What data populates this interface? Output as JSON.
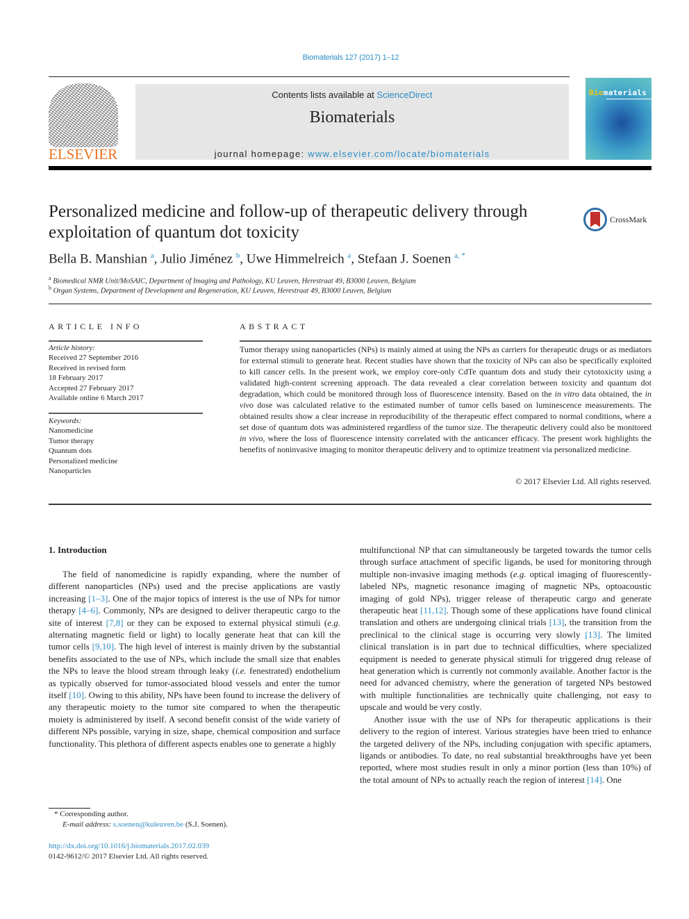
{
  "header": {
    "citation": "Biomaterials 127 (2017) 1–12",
    "contents_prefix": "Contents lists available at ",
    "contents_link": "ScienceDirect",
    "journal_name": "Biomaterials",
    "homepage_prefix": "journal homepage: ",
    "homepage_link": "www.elsevier.com/locate/biomaterials",
    "publisher": "ELSEVIER",
    "cover_title_bold": "Bio",
    "cover_title_rest": "materials",
    "crossmark": "CrossMark"
  },
  "article": {
    "title": "Personalized medicine and follow-up of therapeutic delivery through exploitation of quantum dot toxicity",
    "authors": [
      {
        "name": "Bella B. Manshian",
        "sup": "a"
      },
      {
        "name": "Julio Jiménez",
        "sup": "b"
      },
      {
        "name": "Uwe Himmelreich",
        "sup": "a"
      },
      {
        "name": "Stefaan J. Soenen",
        "sup": "a, *"
      }
    ],
    "affiliations": [
      {
        "sup": "a",
        "text": "Biomedical NMR Unit/MoSAIC, Department of Imaging and Pathology, KU Leuven, Herestraat 49, B3000 Leuven, Belgium"
      },
      {
        "sup": "b",
        "text": "Organ Systems, Department of Development and Regeneration, KU Leuven, Herestraat 49, B3000 Leuven, Belgium"
      }
    ]
  },
  "article_info": {
    "heading": "ARTICLE INFO",
    "history_label": "Article history:",
    "history": [
      "Received 27 September 2016",
      "Received in revised form",
      "18 February 2017",
      "Accepted 27 February 2017",
      "Available online 6 March 2017"
    ],
    "keywords_label": "Keywords:",
    "keywords": [
      "Nanomedicine",
      "Tumor therapy",
      "Quantum dots",
      "Personalized medicine",
      "Nanoparticles"
    ]
  },
  "abstract": {
    "heading": "ABSTRACT",
    "p1": "Tumor therapy using nanoparticles (NPs) is mainly aimed at using the NPs as carriers for therapeutic drugs or as mediators for external stimuli to generate heat. Recent studies have shown that the toxicity of NPs can also be specifically exploited to kill cancer cells. In the present work, we employ core-only CdTe quantum dots and study their cytotoxicity using a validated high-content screening approach. The data revealed a clear correlation between toxicity and quantum dot degradation, which could be monitored through loss of fluorescence intensity. Based on the ",
    "it1": "in vitro",
    "p2": " data obtained, the ",
    "it2": "in vivo",
    "p3": " dose was calculated relative to the estimated number of tumor cells based on luminescence measurements. The obtained results show a clear increase in reproducibility of the therapeutic effect compared to normal conditions, where a set dose of quantum dots was administered regardless of the tumor size. The therapeutic delivery could also be monitored ",
    "it3": "in vivo",
    "p4": ", where the loss of fluorescence intensity correlated with the anticancer efficacy. The present work highlights the benefits of noninvasive imaging to monitor therapeutic delivery and to optimize treatment via personalized medicine.",
    "copyright": "© 2017 Elsevier Ltd. All rights reserved."
  },
  "body": {
    "intro_heading": "1.  Introduction",
    "left": {
      "a": "The field of nanomedicine is rapidly expanding, where the number of different nanoparticles (NPs) used and the precise applications are vastly increasing ",
      "r1": "[1–3]",
      "b": ". One of the major topics of interest is the use of NPs for tumor therapy ",
      "r2": "[4–6]",
      "c": ". Commonly, NPs are designed to deliver therapeutic cargo to the site of interest ",
      "r3": "[7,8]",
      "d": " or they can be exposed to external physical stimuli (",
      "eg": "e.g.",
      "e": " alternating magnetic field or light) to locally generate heat that can kill the tumor cells ",
      "r4": "[9,10]",
      "f": ". The high level of interest is mainly driven by the substantial benefits associated to the use of NPs, which include the small size that enables the NPs to leave the blood stream through leaky (",
      "ie": "i.e.",
      "g": " fenestrated) endothelium as typically observed for tumor-associated blood vessels and enter the tumor itself ",
      "r5": "[10]",
      "h": ". Owing to this ability, NPs have been found to increase the delivery of any therapeutic moiety to the tumor site compared to when the therapeutic moiety is administered by itself. A second benefit consist of the wide variety of different NPs possible, varying in size, shape, chemical composition and surface functionality. This plethora of different aspects enables one to generate a highly"
    },
    "right": {
      "a": "multifunctional NP that can simultaneously be targeted towards the tumor cells through surface attachment of specific ligands, be used for monitoring through multiple non-invasive imaging methods (",
      "eg": "e.g.",
      "b": " optical imaging of fluorescently-labeled NPs, magnetic resonance imaging of magnetic NPs, optoacoustic imaging of gold NPs), trigger release of therapeutic cargo and generate therapeutic heat ",
      "r1": "[11,12]",
      "c": ". Though some of these applications have found clinical translation and others are undergoing clinical trials ",
      "r2": "[13]",
      "d": ", the transition from the preclinical to the clinical stage is occurring very slowly ",
      "r3": "[13]",
      "e": ". The limited clinical translation is in part due to technical difficulties, where specialized equipment is needed to generate physical stimuli for triggered drug release of heat generation which is currently not commonly available. Another factor is the need for advanced chemistry, where the generation of targeted NPs bestowed with multiple functionalities are technically quite challenging, not easy to upscale and would be very costly.",
      "p2a": "Another issue with the use of NPs for therapeutic applications is their delivery to the region of interest. Various strategies have been tried to enhance the targeted delivery of the NPs, including conjugation with specific aptamers, ligands or antibodies. To date, no real substantial breakthroughs have yet been reported, where most studies result in only a minor portion (less than 10%) of the total amount of NPs to actually reach the region of interest ",
      "r4": "[14]",
      "p2b": ". One"
    }
  },
  "footnotes": {
    "corresponding": "* Corresponding author.",
    "email_label": "E-mail address: ",
    "email": "s.soenen@kuleuven.be",
    "email_suffix": " (S.J. Soenen).",
    "doi": "http://dx.doi.org/10.1016/j.biomaterials.2017.02.039",
    "issn": "0142-9612/© 2017 Elsevier Ltd. All rights reserved."
  }
}
